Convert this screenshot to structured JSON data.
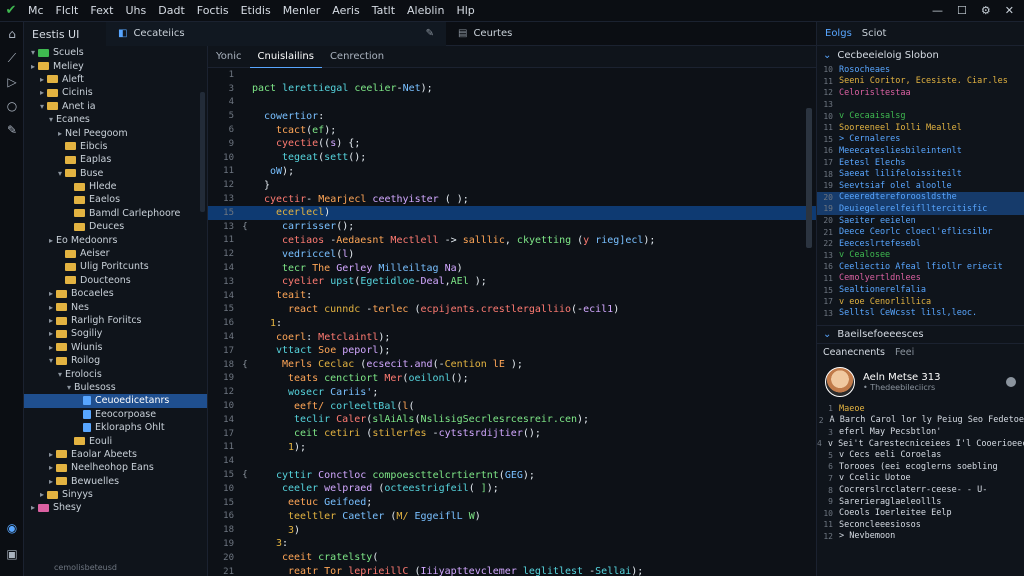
{
  "menubar": {
    "items": [
      "Mc",
      "Flclt",
      "Fext",
      "Uhs",
      "Dadt",
      "Foctis",
      "Etidis",
      "Menler",
      "Aeris",
      "Tatlt",
      "Aleblin",
      "Hlp"
    ],
    "controls": [
      "—",
      "☐",
      "⚙",
      "✕"
    ]
  },
  "explorer": {
    "title": "Eestis UI",
    "tab_label": "Cecateiics",
    "rows": [
      {
        "indent": 0,
        "twisty": "▾",
        "icon": "green",
        "label": "Scuels"
      },
      {
        "indent": 0,
        "twisty": "▸",
        "icon": "folder",
        "label": "Meliey"
      },
      {
        "indent": 1,
        "twisty": "▸",
        "icon": "folder",
        "label": "Aleft"
      },
      {
        "indent": 1,
        "twisty": "▸",
        "icon": "folder",
        "label": "Cicinis"
      },
      {
        "indent": 1,
        "twisty": "▾",
        "icon": "folder",
        "label": "Anet ia"
      },
      {
        "indent": 2,
        "twisty": "▾",
        "icon": "",
        "label": "Ecanes"
      },
      {
        "indent": 3,
        "twisty": "▸",
        "icon": "",
        "label": "Nel Peegoom"
      },
      {
        "indent": 3,
        "twisty": "",
        "icon": "folder",
        "label": "Eibcis"
      },
      {
        "indent": 3,
        "twisty": "",
        "icon": "folder",
        "label": "Eaplas"
      },
      {
        "indent": 3,
        "twisty": "▾",
        "icon": "folder",
        "label": "Buse"
      },
      {
        "indent": 4,
        "twisty": "",
        "icon": "folder",
        "label": "Hlede"
      },
      {
        "indent": 4,
        "twisty": "",
        "icon": "folder",
        "label": "Eaelos"
      },
      {
        "indent": 4,
        "twisty": "",
        "icon": "folder",
        "label": "Bamdl Carlephoore"
      },
      {
        "indent": 4,
        "twisty": "",
        "icon": "folder",
        "label": "Deuces"
      },
      {
        "indent": 2,
        "twisty": "▸",
        "icon": "",
        "label": "Eo Medoonrs"
      },
      {
        "indent": 3,
        "twisty": "",
        "icon": "folder",
        "label": "Aeiser"
      },
      {
        "indent": 3,
        "twisty": "",
        "icon": "folder",
        "label": "Ulig Poritcunts"
      },
      {
        "indent": 3,
        "twisty": "",
        "icon": "folder",
        "label": "Doucteons"
      },
      {
        "indent": 2,
        "twisty": "▸",
        "icon": "folder",
        "label": "Bocaeles"
      },
      {
        "indent": 2,
        "twisty": "▸",
        "icon": "folder",
        "label": "Nes"
      },
      {
        "indent": 2,
        "twisty": "▸",
        "icon": "folder",
        "label": "Rarligh Foriitcs"
      },
      {
        "indent": 2,
        "twisty": "▸",
        "icon": "folder",
        "label": "Sogiliy"
      },
      {
        "indent": 2,
        "twisty": "▸",
        "icon": "folder",
        "label": "Wiunis"
      },
      {
        "indent": 2,
        "twisty": "▾",
        "icon": "folder",
        "label": "Roilog"
      },
      {
        "indent": 3,
        "twisty": "▾",
        "icon": "",
        "label": "Erolocis"
      },
      {
        "indent": 4,
        "twisty": "▾",
        "icon": "",
        "label": "Bulesoss"
      },
      {
        "indent": 5,
        "twisty": "",
        "icon": "file",
        "label": "Ceuoedicetanrs",
        "active": true
      },
      {
        "indent": 5,
        "twisty": "",
        "icon": "file",
        "label": "Eeocorpoase"
      },
      {
        "indent": 5,
        "twisty": "",
        "icon": "file",
        "label": "Ekloraphs Ohlt"
      },
      {
        "indent": 4,
        "twisty": "",
        "icon": "folder",
        "label": "Eouli"
      },
      {
        "indent": 2,
        "twisty": "▸",
        "icon": "folder",
        "label": "Eaolar Abeets"
      },
      {
        "indent": 2,
        "twisty": "▸",
        "icon": "folder",
        "label": "Neelheohop Eans"
      },
      {
        "indent": 2,
        "twisty": "▸",
        "icon": "folder",
        "label": "Bewuelles"
      },
      {
        "indent": 1,
        "twisty": "▸",
        "icon": "folder",
        "label": "Sinyys"
      },
      {
        "indent": 0,
        "twisty": "▸",
        "icon": "pink",
        "label": "Shesy"
      }
    ],
    "status": "cemolisbeteusd"
  },
  "editor": {
    "tab_label": "Ceurtes",
    "subtabs": [
      "Yonic",
      "Cnuislailins",
      "Cenrection"
    ],
    "lines": [
      {
        "n": "1",
        "m": "",
        "t": "",
        "indent": 0
      },
      {
        "n": "3",
        "m": "",
        "t": "pact lerettiegal ceelier-Net);",
        "indent": 0
      },
      {
        "n": "4",
        "m": "",
        "t": "",
        "indent": 0
      },
      {
        "n": "5",
        "m": "",
        "t": "cowertior:",
        "indent": 2
      },
      {
        "n": "6",
        "m": "",
        "t": "tcact(ef);",
        "indent": 4
      },
      {
        "n": "9",
        "m": "",
        "t": "cyectie((s) {;",
        "indent": 4
      },
      {
        "n": "10",
        "m": "",
        "t": "tegeat(sett();",
        "indent": 5
      },
      {
        "n": "11",
        "m": "",
        "t": "oW);",
        "indent": 3
      },
      {
        "n": "12",
        "m": "",
        "t": "}",
        "indent": 2
      },
      {
        "n": "13",
        "m": "",
        "t": "cyectir- Mearjecl ceethyister ( );",
        "indent": 2
      },
      {
        "n": "15",
        "m": "",
        "t": "ecerlecl)",
        "indent": 4,
        "hl": true
      },
      {
        "n": "13",
        "m": "{",
        "t": "carrisser();",
        "indent": 5
      },
      {
        "n": "11",
        "m": "",
        "t": "cetiaos -Aedaesnt Mectlell -> salllic, ckyetting (y rieg]ecl);",
        "indent": 5
      },
      {
        "n": "12",
        "m": "",
        "t": "vedriccel(l)",
        "indent": 5
      },
      {
        "n": "14",
        "m": "",
        "t": "tecr The Gerley Milleiltag Na)",
        "indent": 5
      },
      {
        "n": "13",
        "m": "",
        "t": "cyelier upst(Egetidloe-Deal,AEl );",
        "indent": 5
      },
      {
        "n": "14",
        "m": "",
        "t": "teait:",
        "indent": 4
      },
      {
        "n": "15",
        "m": "",
        "t": "react cunndc -terlec (ecpijents.crestlergalliio(-ecil1)",
        "indent": 6
      },
      {
        "n": "16",
        "m": "",
        "t": "1:",
        "indent": 3
      },
      {
        "n": "14",
        "m": "",
        "t": "coerl: Metclaintl);",
        "indent": 4
      },
      {
        "n": "17",
        "m": "",
        "t": "vttact Soe peporl);",
        "indent": 4
      },
      {
        "n": "18",
        "m": "{",
        "t": "Merls Ceclac (ecsecit.and(-Cention lE );",
        "indent": 5
      },
      {
        "n": "19",
        "m": "",
        "t": "teats cenctiort Mer(oeilonl();",
        "indent": 6
      },
      {
        "n": "12",
        "m": "",
        "t": "wosecr Cariis';",
        "indent": 6
      },
      {
        "n": "10",
        "m": "",
        "t": "eeft/ corleeltBal(l(",
        "indent": 7
      },
      {
        "n": "14",
        "m": "",
        "t": "teclir Caler(slAiAls(NslisigSecrlesrcesreir.cen);",
        "indent": 7
      },
      {
        "n": "17",
        "m": "",
        "t": "ceit cetiri (stilerfes -cytstsrdijtier();",
        "indent": 7
      },
      {
        "n": "11",
        "m": "",
        "t": "1);",
        "indent": 6
      },
      {
        "n": "14",
        "m": "",
        "t": "",
        "indent": 0
      },
      {
        "n": "15",
        "m": "{",
        "t": "cyttir Conctloc compoescttelcrtiertnt(GEG);",
        "indent": 4
      },
      {
        "n": "10",
        "m": "",
        "t": "ceeler welpraed (octeestrigfeil( ]);",
        "indent": 5
      },
      {
        "n": "15",
        "m": "",
        "t": "eetuc Geifoed;",
        "indent": 6
      },
      {
        "n": "16",
        "m": "",
        "t": "teeltler Caetler (M/ EggeiflL W)",
        "indent": 6
      },
      {
        "n": "18",
        "m": "",
        "t": "3)",
        "indent": 6
      },
      {
        "n": "19",
        "m": "",
        "t": "3:",
        "indent": 4
      },
      {
        "n": "20",
        "m": "",
        "t": "ceeit cratelsty(",
        "indent": 5
      },
      {
        "n": "21",
        "m": "",
        "t": "reatr Tor leprieillC (Iiiyapttevclemer leglitlest -Sellai);",
        "indent": 6
      }
    ]
  },
  "rightpanel": {
    "tabs": [
      "Eolgs",
      "Sciot"
    ],
    "section1": "Cecbeeieloig Slobon",
    "rows": [
      {
        "n": "10",
        "t": "Rosocheaes",
        "c": "#58a6ff",
        "hl": false
      },
      {
        "n": "11",
        "t": "  Seeni Coritor, Ecesiste. Ciar.les",
        "c": "#e3b341",
        "hl": false
      },
      {
        "n": "12",
        "t": "  Celorisltestaa",
        "c": "#db61a2",
        "hl": false
      },
      {
        "n": "13",
        "t": "",
        "c": "#58a6ff",
        "hl": false
      },
      {
        "n": "10",
        "t": "v Cecaaisalsg",
        "c": "#3fb950",
        "hl": false
      },
      {
        "n": "11",
        "t": "   Sooreeneel Iolli Meallel",
        "c": "#e3b341",
        "hl": false
      },
      {
        "n": "15",
        "t": "> Cernaleres",
        "c": "#58a6ff",
        "hl": false
      },
      {
        "n": "16",
        "t": "   Meeecatesliesbileintenlt",
        "c": "#58a6ff",
        "hl": false
      },
      {
        "n": "17",
        "t": "   Eetesl Elechs",
        "c": "#58a6ff",
        "hl": false
      },
      {
        "n": "18",
        "t": "   Saeeat lilifeloissiteilt",
        "c": "#58a6ff",
        "hl": false
      },
      {
        "n": "19",
        "t": "   Seevtsiaf olel aloolle",
        "c": "#58a6ff",
        "hl": false
      },
      {
        "n": "20",
        "t": "   Ceeeredtereforoosldsthe",
        "c": "#58a6ff",
        "hl": true
      },
      {
        "n": "19",
        "t": "   Deuiegelerelfeiflltercitisfic",
        "c": "#58a6ff",
        "hl": true
      },
      {
        "n": "20",
        "t": "   Saeiter eeielen",
        "c": "#58a6ff",
        "hl": false
      },
      {
        "n": "21",
        "t": "   Deece Ceorlc cloecl'eflicsilbr",
        "c": "#58a6ff",
        "hl": false
      },
      {
        "n": "22",
        "t": "   Eeeceslrtefesebl",
        "c": "#58a6ff",
        "hl": false
      },
      {
        "n": "13",
        "t": "v Cealosee",
        "c": "#3fb950",
        "hl": false
      },
      {
        "n": "16",
        "t": "Ceeliectio Afeal lfiollr eriecit",
        "c": "#58a6ff",
        "hl": false
      },
      {
        "n": "11",
        "t": "Cemolyertldnlees",
        "c": "#db61a2",
        "hl": false
      },
      {
        "n": "15",
        "t": "Sealtionerelfalia",
        "c": "#58a6ff",
        "hl": false
      },
      {
        "n": "17",
        "t": "v eoe Cenorlillica",
        "c": "#e3b341",
        "hl": false
      },
      {
        "n": "13",
        "t": "   Selltsl CeWcsst lilsl,leoc.",
        "c": "#58a6ff",
        "hl": false
      }
    ],
    "section2": "Baeilsefoeeesces",
    "comments_label": "Ceanecnents",
    "comments_sub": "Feei",
    "user_name": "Aeln Metse 313",
    "user_sub": "• Thedeebileciicrs",
    "comment_rows": [
      {
        "n": "1",
        "t": "Maeoe",
        "c": "#e3b341"
      },
      {
        "n": "2",
        "t": "A Barch Carol lor ly Peiug Seo Fedetoe",
        "c": "#d6dce4"
      },
      {
        "n": "3",
        "t": "eferl May Pecsbtlon'",
        "c": "#d6dce4"
      },
      {
        "n": "4",
        "t": "v Sei't Carestecniceiees I'l Cooerioeec",
        "c": "#d6dce4"
      },
      {
        "n": "5",
        "t": "  v Cecs eeli Coroelas",
        "c": "#d6dce4"
      },
      {
        "n": "6",
        "t": "     Torooes (eei ecoglerns soebling",
        "c": "#d6dce4"
      },
      {
        "n": "7",
        "t": "  v Ccelic Uotoe",
        "c": "#d6dce4"
      },
      {
        "n": "8",
        "t": "     Cocrerslrcclaterr-ceese- - U-",
        "c": "#d6dce4"
      },
      {
        "n": "9",
        "t": "       Sarerieraglaeleollls",
        "c": "#d6dce4"
      },
      {
        "n": "10",
        "t": "       Coeols Ioerleitee Eelp",
        "c": "#d6dce4"
      },
      {
        "n": "11",
        "t": "       Seconcleeesiosos",
        "c": "#d6dce4"
      },
      {
        "n": "12",
        "t": "  > Nevbemoon",
        "c": "#d6dce4"
      }
    ]
  }
}
